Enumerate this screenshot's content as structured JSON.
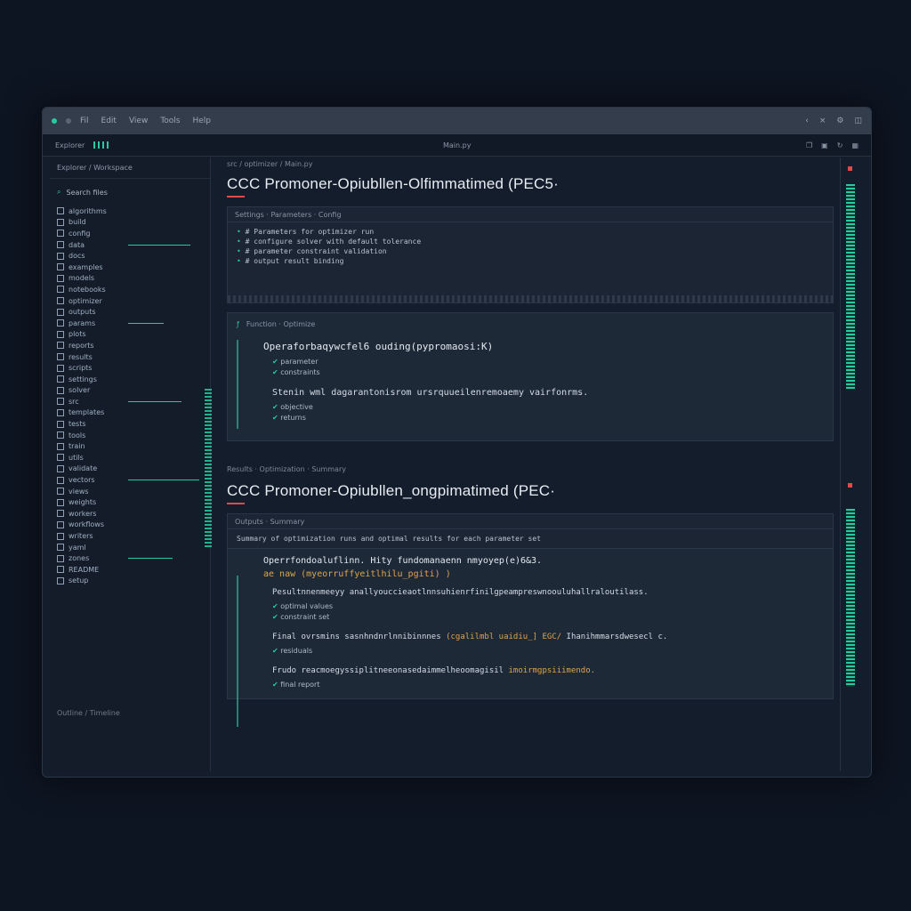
{
  "titlebar": {
    "menu": [
      "Fil",
      "Edit",
      "View",
      "Tools",
      "Help"
    ],
    "right_icons": [
      "chevron-icon",
      "close-icon",
      "settings-icon",
      "window-icon"
    ]
  },
  "toolbar": {
    "left": "Explorer",
    "center": "Main.py",
    "icons": [
      "copy-icon",
      "save-icon",
      "refresh-icon",
      "layout-icon"
    ]
  },
  "sidebar": {
    "header": "Explorer / Workspace",
    "search_label": "Search files",
    "files": [
      "algorithms",
      "build",
      "config",
      "data",
      "docs",
      "examples",
      "models",
      "notebooks",
      "optimizer",
      "outputs",
      "params",
      "plots",
      "reports",
      "results",
      "scripts",
      "settings",
      "solver",
      "src",
      "templates",
      "tests",
      "tools",
      "train",
      "utils",
      "validate",
      "vectors",
      "views",
      "weights",
      "workers",
      "workflows",
      "writers",
      "yaml",
      "zones",
      "README",
      "setup"
    ],
    "footer": "Outline / Timeline"
  },
  "section1": {
    "breadcrumb": "src / optimizer / Main.py",
    "title": "CCC Promoner-Opiubllen-Olfimmatimed (PEC5·",
    "panel_head": "Settings · Parameters · Config",
    "code": [
      "# Parameters for optimizer run",
      "# configure solver with default tolerance",
      "# parameter constraint validation",
      "# output result binding"
    ],
    "card_title": "Function · Optimize",
    "function_sig": "Operaforbaqywcfel6 ouding(pypromaosi:K)",
    "bullets_a": [
      "parameter",
      "constraints"
    ],
    "description": "Stenin wml dagarantonisrom ursrquueilenremoaemy vairfonrms.",
    "bullets_b": [
      "objective",
      "returns"
    ]
  },
  "section2": {
    "breadcrumb": "Results · Optimization · Summary",
    "title": "CCC Promoner-Opiubllen_ongpimatimed (PEC·",
    "panel_head": "Outputs · Summary",
    "summary_line": "Summary of optimization runs and optimal results for each parameter set",
    "function_sig": "Operrfondoaluflinn. Hity fundomanaenn nmyoyep(e)6&3.",
    "function_sig_2": "ae naw (myeorruffyeitlhilu_pgiti) )",
    "description_1": "Pesultnnenmeeyy anallyouccieaotlnnsuhienrfinilgpeampreswnoouluhallraloutilass.",
    "bullets_a": [
      "optimal values",
      "constraint set"
    ],
    "description_2": "Final ovrsmins sasnhndnrlnnibinnnes",
    "highlight_2": "(cgalilmbl uaidiu_] EGC/",
    "tail_2": "Ihanihmmarsdwesecl c.",
    "bullets_b": [
      "residuals"
    ],
    "description_3": "Frudo reacmoegyssiplitneeonasedaimmelheoomagisil",
    "highlight_3": "imoirmgpsiiimendo.",
    "bullets_c": [
      "final report"
    ]
  },
  "colors": {
    "accent": "#27c9a0",
    "alert": "#e04a4a",
    "highlight": "#e0a34a"
  }
}
